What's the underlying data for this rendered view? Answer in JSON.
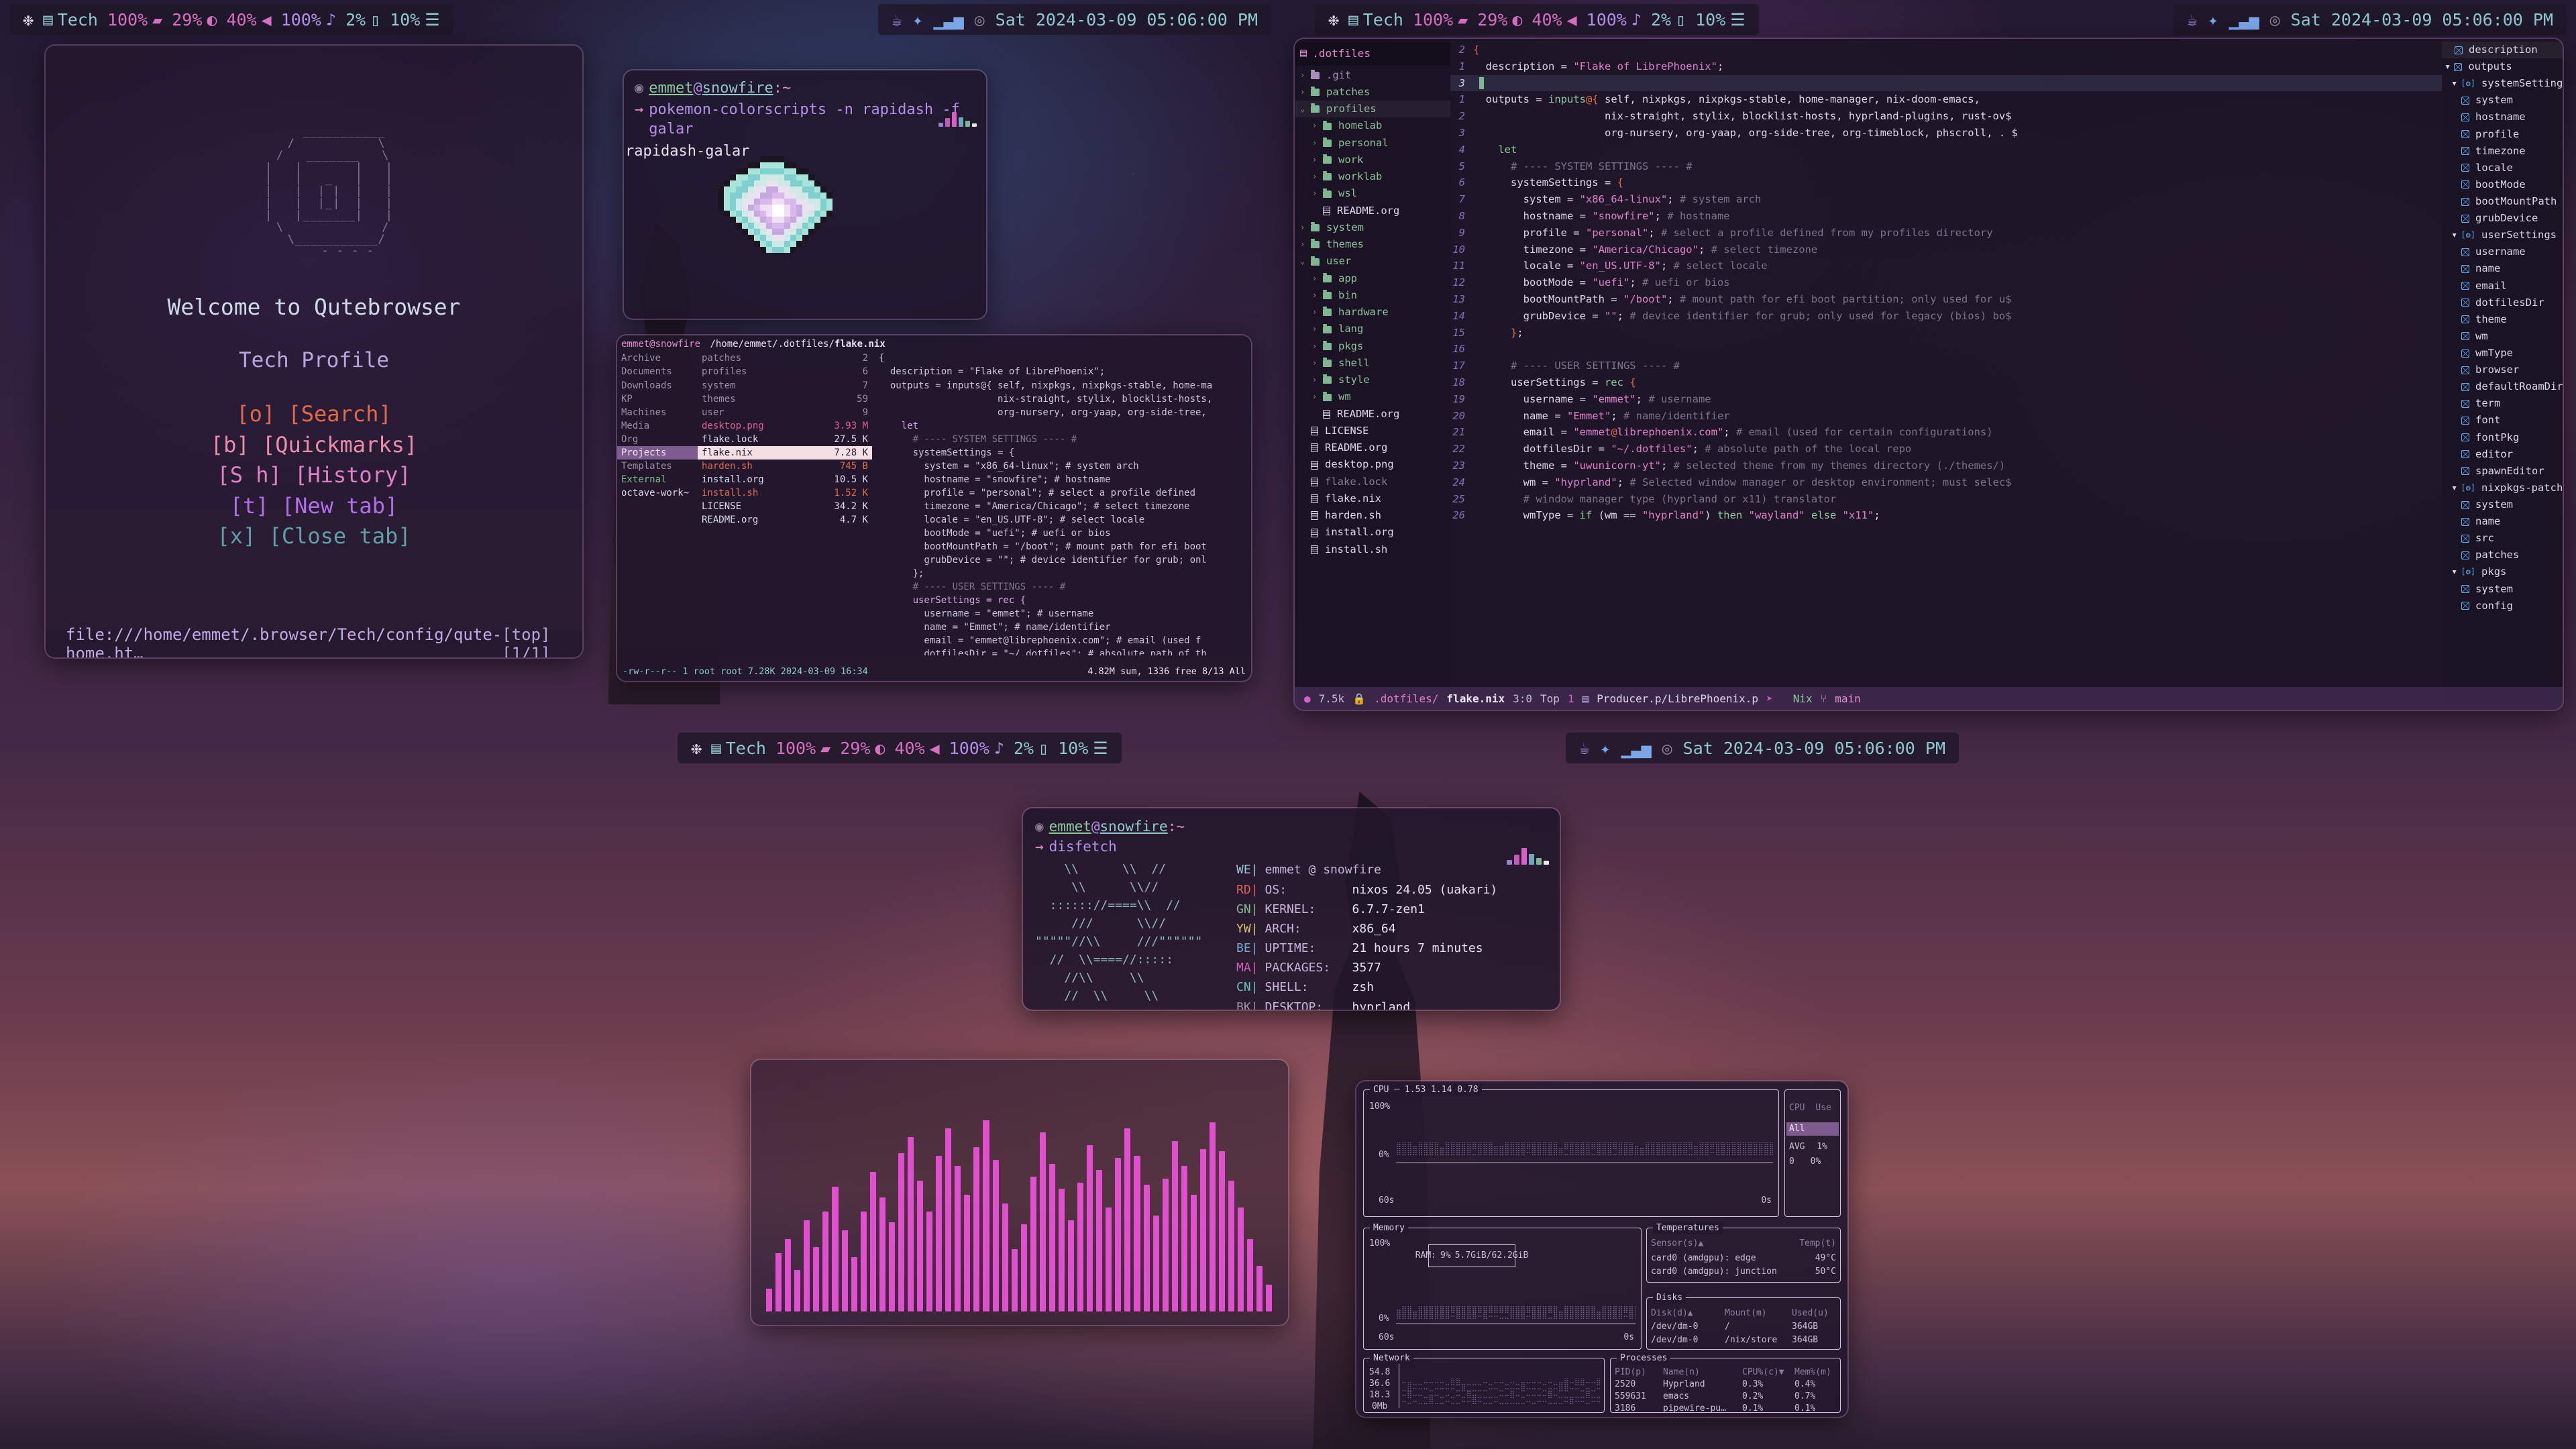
{
  "topbar_left": {
    "icons": [
      "nixos-snowflake-icon",
      "workspace-stack-icon"
    ],
    "workspace": "Tech",
    "items": [
      {
        "name": "battery",
        "value": "100%",
        "icon": "battery-icon"
      },
      {
        "name": "brightness",
        "value": "29%",
        "icon": "brightness-icon"
      },
      {
        "name": "volume-pct",
        "value": "40%",
        "icon": "speaker-icon"
      },
      {
        "name": "mic",
        "value": "100%",
        "icon": "microphone-icon"
      },
      {
        "name": "cpu",
        "value": "2%",
        "icon": "cpu-icon"
      },
      {
        "name": "memory",
        "value": "10%",
        "icon": "memory-icon"
      }
    ]
  },
  "topbar_right": {
    "tray": [
      "coffee-off-icon",
      "bluetooth-icon",
      "network-signal-icon",
      "disc-icon"
    ],
    "clock": "Sat 2024-03-09 05:06:00 PM"
  },
  "qutebrowser": {
    "welcome": "Welcome to Qutebrowser",
    "profile": "Tech Profile",
    "ascii": "        ___________\n      /           \\\n     /   _______   \\\n    |   |       |   |\n    |   |   _   |   |\n    |   |  | |  |   |\n    |   |  |_|  |   |\n    |   |_______|   |\n     \\             /\n      \\___________/\n         - - - -",
    "links": [
      {
        "key": "[o]",
        "label": "[Search]",
        "color": "#e0694a"
      },
      {
        "key": "[b]",
        "label": "[Quickmarks]",
        "color": "#f08bad"
      },
      {
        "key": "[S h]",
        "label": "[History]",
        "color": "#e07fc8"
      },
      {
        "key": "[t]",
        "label": "[New tab]",
        "color": "#b06ee8"
      },
      {
        "key": "[x]",
        "label": "[Close tab]",
        "color": "#5f9fa8"
      }
    ],
    "status_url": "file:///home/emmet/.browser/Tech/config/qute-home.ht…",
    "status_pos": "[top] [1/1]"
  },
  "terminal_top": {
    "prompt_user": "emmet",
    "prompt_at": "@",
    "prompt_host": "snowfire",
    "prompt_path": ":~",
    "command": "pokemon-colorscripts -n rapidash -f galar",
    "output": "rapidash-galar"
  },
  "ranger": {
    "header_user": "emmet@snowfire",
    "header_path": "/home/emmet/.dotfiles/",
    "header_file": "flake.nix",
    "col1": [
      "Archive",
      "Documents",
      "Downloads",
      "KP",
      "Machines",
      "Media",
      "Org",
      "Projects",
      "Templates",
      "External",
      "octave-work~"
    ],
    "col1_selected": "Projects",
    "col2": [
      {
        "name": "patches",
        "size": "2",
        "type": "dir"
      },
      {
        "name": "profiles",
        "size": "6",
        "type": "dir"
      },
      {
        "name": "system",
        "size": "7",
        "type": "dir"
      },
      {
        "name": "themes",
        "size": "59",
        "type": "dir"
      },
      {
        "name": "user",
        "size": "9",
        "type": "dir"
      },
      {
        "name": "desktop.png",
        "size": "3.93 M",
        "type": "image"
      },
      {
        "name": "flake.lock",
        "size": "27.5 K",
        "type": "file"
      },
      {
        "name": "flake.nix",
        "size": "7.28 K",
        "type": "selected"
      },
      {
        "name": "harden.sh",
        "size": "745 B",
        "type": "exec"
      },
      {
        "name": "install.org",
        "size": "10.5 K",
        "type": "file"
      },
      {
        "name": "install.sh",
        "size": "1.52 K",
        "type": "exec"
      },
      {
        "name": "LICENSE",
        "size": "34.2 K",
        "type": "file"
      },
      {
        "name": "README.org",
        "size": "4.7 K",
        "type": "file"
      }
    ],
    "statusline": "-rw-r--r-- 1 root root 7.28K 2024-03-09 16:34",
    "statusright": "4.82M sum, 1336 free  8/13  All",
    "preview": [
      "{",
      "",
      "  description = \"Flake of LibrePhoenix\";",
      "",
      "  outputs = inputs@{ self, nixpkgs, nixpkgs-stable, home-ma",
      "                     nix-straight, stylix, blocklist-hosts,",
      "                     org-nursery, org-yaap, org-side-tree,",
      "",
      "    let",
      "      # ---- SYSTEM SETTINGS ---- #",
      "      systemSettings = {",
      "        system = \"x86_64-linux\"; # system arch",
      "        hostname = \"snowfire\"; # hostname",
      "        profile = \"personal\"; # select a profile defined",
      "        timezone = \"America/Chicago\"; # select timezone",
      "        locale = \"en_US.UTF-8\"; # select locale",
      "        bootMode = \"uefi\"; # uefi or bios",
      "        bootMountPath = \"/boot\"; # mount path for efi boot",
      "        grubDevice = \"\"; # device identifier for grub; onl",
      "      };",
      "",
      "      # ---- USER SETTINGS ---- #",
      "      userSettings = rec {",
      "        username = \"emmet\"; # username",
      "        name = \"Emmet\"; # name/identifier",
      "        email = \"emmet@librephoenix.com\"; # email (used f",
      "        dotfilesDir = \"~/.dotfiles\"; # absolute path of th"
    ]
  },
  "emacs": {
    "project_title": ".dotfiles",
    "tree": [
      {
        "label": ".git",
        "indent": 0,
        "chev": "›",
        "icon": "folder-icon",
        "color": "#a98cc0"
      },
      {
        "label": "patches",
        "indent": 0,
        "chev": "›",
        "icon": "folder-icon"
      },
      {
        "label": "profiles",
        "indent": 0,
        "chev": "⌄",
        "icon": "folder-icon",
        "hl": true
      },
      {
        "label": "homelab",
        "indent": 1,
        "chev": "›",
        "icon": "folder-icon"
      },
      {
        "label": "personal",
        "indent": 1,
        "chev": "›",
        "icon": "folder-icon"
      },
      {
        "label": "work",
        "indent": 1,
        "chev": "›",
        "icon": "folder-icon"
      },
      {
        "label": "worklab",
        "indent": 1,
        "chev": "›",
        "icon": "folder-icon"
      },
      {
        "label": "wsl",
        "indent": 1,
        "chev": "›",
        "icon": "folder-icon"
      },
      {
        "label": "README.org",
        "indent": 1,
        "chev": "",
        "icon": "file-icon",
        "file": true
      },
      {
        "label": "system",
        "indent": 0,
        "chev": "›",
        "icon": "folder-icon"
      },
      {
        "label": "themes",
        "indent": 0,
        "chev": "›",
        "icon": "folder-icon"
      },
      {
        "label": "user",
        "indent": 0,
        "chev": "⌄",
        "icon": "folder-icon"
      },
      {
        "label": "app",
        "indent": 1,
        "chev": "›",
        "icon": "folder-icon"
      },
      {
        "label": "bin",
        "indent": 1,
        "chev": "›",
        "icon": "folder-icon"
      },
      {
        "label": "hardware",
        "indent": 1,
        "chev": "›",
        "icon": "folder-icon"
      },
      {
        "label": "lang",
        "indent": 1,
        "chev": "›",
        "icon": "folder-icon"
      },
      {
        "label": "pkgs",
        "indent": 1,
        "chev": "›",
        "icon": "folder-icon"
      },
      {
        "label": "shell",
        "indent": 1,
        "chev": "›",
        "icon": "folder-icon"
      },
      {
        "label": "style",
        "indent": 1,
        "chev": "›",
        "icon": "folder-icon"
      },
      {
        "label": "wm",
        "indent": 1,
        "chev": "›",
        "icon": "folder-icon"
      },
      {
        "label": "README.org",
        "indent": 1,
        "chev": "",
        "icon": "file-icon",
        "file": true
      },
      {
        "label": "LICENSE",
        "indent": 0,
        "chev": "",
        "icon": "file-icon",
        "file": true
      },
      {
        "label": "README.org",
        "indent": 0,
        "chev": "",
        "icon": "file-icon",
        "file": true
      },
      {
        "label": "desktop.png",
        "indent": 0,
        "chev": "",
        "icon": "image-icon",
        "file": true
      },
      {
        "label": "flake.lock",
        "indent": 0,
        "chev": "",
        "icon": "binary-icon",
        "file": true,
        "dim": true
      },
      {
        "label": "flake.nix",
        "indent": 0,
        "chev": "",
        "icon": "file-icon",
        "file": true
      },
      {
        "label": "harden.sh",
        "indent": 0,
        "chev": "",
        "icon": "binary-icon",
        "file": true
      },
      {
        "label": "install.org",
        "indent": 0,
        "chev": "",
        "icon": "file-icon",
        "file": true
      },
      {
        "label": "install.sh",
        "indent": 0,
        "chev": "",
        "icon": "binary-icon",
        "file": true
      }
    ],
    "code_lines": [
      {
        "num": "2",
        "text": "{"
      },
      {
        "num": "1",
        "text": "  description = \"Flake of LibrePhoenix\";"
      },
      {
        "num": "3",
        "text": "",
        "cursor": true
      },
      {
        "num": "1",
        "text": "  outputs = inputs@{ self, nixpkgs, nixpkgs-stable, home-manager, nix-doom-emacs,"
      },
      {
        "num": "2",
        "text": "                     nix-straight, stylix, blocklist-hosts, hyprland-plugins, rust-ov$"
      },
      {
        "num": "3",
        "text": "                     org-nursery, org-yaap, org-side-tree, org-timeblock, phscroll, . $"
      },
      {
        "num": "4",
        "text": "    let"
      },
      {
        "num": "5",
        "text": "      # ---- SYSTEM SETTINGS ---- #"
      },
      {
        "num": "6",
        "text": "      systemSettings = {"
      },
      {
        "num": "7",
        "text": "        system = \"x86_64-linux\"; # system arch"
      },
      {
        "num": "8",
        "text": "        hostname = \"snowfire\"; # hostname"
      },
      {
        "num": "9",
        "text": "        profile = \"personal\"; # select a profile defined from my profiles directory"
      },
      {
        "num": "10",
        "text": "        timezone = \"America/Chicago\"; # select timezone"
      },
      {
        "num": "11",
        "text": "        locale = \"en_US.UTF-8\"; # select locale"
      },
      {
        "num": "12",
        "text": "        bootMode = \"uefi\"; # uefi or bios"
      },
      {
        "num": "13",
        "text": "        bootMountPath = \"/boot\"; # mount path for efi boot partition; only used for u$"
      },
      {
        "num": "14",
        "text": "        grubDevice = \"\"; # device identifier for grub; only used for legacy (bios) bo$"
      },
      {
        "num": "15",
        "text": "      };"
      },
      {
        "num": "16",
        "text": ""
      },
      {
        "num": "17",
        "text": "      # ---- USER SETTINGS ---- #"
      },
      {
        "num": "18",
        "text": "      userSettings = rec {"
      },
      {
        "num": "19",
        "text": "        username = \"emmet\"; # username"
      },
      {
        "num": "20",
        "text": "        name = \"Emmet\"; # name/identifier"
      },
      {
        "num": "21",
        "text": "        email = \"emmet@librephoenix.com\"; # email (used for certain configurations)"
      },
      {
        "num": "22",
        "text": "        dotfilesDir = \"~/.dotfiles\"; # absolute path of the local repo"
      },
      {
        "num": "23",
        "text": "        theme = \"uwunicorn-yt\"; # selected theme from my themes directory (./themes/)"
      },
      {
        "num": "24",
        "text": "        wm = \"hyprland\"; # Selected window manager or desktop environment; must selec$"
      },
      {
        "num": "25",
        "text": "        # window manager type (hyprland or x11) translator"
      },
      {
        "num": "26",
        "text": "        wmType = if (wm == \"hyprland\") then \"wayland\" else \"x11\";"
      }
    ],
    "imenu": [
      {
        "label": "description",
        "indent": 1,
        "icon": "cube-icon",
        "hl": true
      },
      {
        "label": "outputs",
        "indent": 0,
        "icon": "cube-icon",
        "chev": "▾"
      },
      {
        "label": "systemSettings",
        "indent": 1,
        "icon": "bracket-icon",
        "chev": "▾"
      },
      {
        "label": "system",
        "indent": 2,
        "icon": "cube-icon"
      },
      {
        "label": "hostname",
        "indent": 2,
        "icon": "cube-icon"
      },
      {
        "label": "profile",
        "indent": 2,
        "icon": "cube-icon"
      },
      {
        "label": "timezone",
        "indent": 2,
        "icon": "cube-icon"
      },
      {
        "label": "locale",
        "indent": 2,
        "icon": "cube-icon"
      },
      {
        "label": "bootMode",
        "indent": 2,
        "icon": "cube-icon"
      },
      {
        "label": "bootMountPath",
        "indent": 2,
        "icon": "cube-icon"
      },
      {
        "label": "grubDevice",
        "indent": 2,
        "icon": "cube-icon"
      },
      {
        "label": "userSettings",
        "indent": 1,
        "icon": "bracket-icon",
        "chev": "▾"
      },
      {
        "label": "username",
        "indent": 2,
        "icon": "cube-icon"
      },
      {
        "label": "name",
        "indent": 2,
        "icon": "cube-icon"
      },
      {
        "label": "email",
        "indent": 2,
        "icon": "cube-icon"
      },
      {
        "label": "dotfilesDir",
        "indent": 2,
        "icon": "cube-icon"
      },
      {
        "label": "theme",
        "indent": 2,
        "icon": "cube-icon"
      },
      {
        "label": "wm",
        "indent": 2,
        "icon": "cube-icon"
      },
      {
        "label": "wmType",
        "indent": 2,
        "icon": "cube-icon"
      },
      {
        "label": "browser",
        "indent": 2,
        "icon": "cube-icon"
      },
      {
        "label": "defaultRoamDir",
        "indent": 2,
        "icon": "cube-icon"
      },
      {
        "label": "term",
        "indent": 2,
        "icon": "cube-icon"
      },
      {
        "label": "font",
        "indent": 2,
        "icon": "cube-icon"
      },
      {
        "label": "fontPkg",
        "indent": 2,
        "icon": "cube-icon"
      },
      {
        "label": "editor",
        "indent": 2,
        "icon": "cube-icon"
      },
      {
        "label": "spawnEditor",
        "indent": 2,
        "icon": "cube-icon"
      },
      {
        "label": "nixpkgs-patched",
        "indent": 1,
        "icon": "bracket-icon",
        "chev": "▾"
      },
      {
        "label": "system",
        "indent": 2,
        "icon": "cube-icon"
      },
      {
        "label": "name",
        "indent": 2,
        "icon": "cube-icon"
      },
      {
        "label": "src",
        "indent": 2,
        "icon": "cube-icon"
      },
      {
        "label": "patches",
        "indent": 2,
        "icon": "cube-icon"
      },
      {
        "label": "pkgs",
        "indent": 1,
        "icon": "bracket-icon",
        "chev": "▾"
      },
      {
        "label": "system",
        "indent": 2,
        "icon": "cube-icon"
      },
      {
        "label": "config",
        "indent": 2,
        "icon": "cube-icon"
      }
    ],
    "modeline": {
      "size": "7.5k",
      "lock_icon": "lock-icon",
      "dir": ".dotfiles/",
      "file": "flake.nix",
      "pos": "3:0",
      "scroll": "Top",
      "scroll_num": "1",
      "stack_icon": "stack-icon",
      "project": "Producer.p/LibrePhoenix.p",
      "rocket_icon": "rocket-icon",
      "mode": "Nix",
      "branch_icon": "git-branch-icon",
      "branch": "main"
    }
  },
  "fastfetch": {
    "prompt_user": "emmet",
    "prompt_at": "@",
    "prompt_host": "snowfire",
    "prompt_path": ":~",
    "command": "disfetch",
    "logo": [
      "    \\\\      \\\\  //",
      "     \\\\      \\\\//",
      "  :::::://====\\\\  //",
      "     ///      \\\\//",
      "\"\"\"\"\"//\\\\     ///\"\"\"\"\"\"",
      "  //  \\\\====//:::::",
      "    //\\\\     \\\\",
      "    //  \\\\     \\\\"
    ],
    "color_tags": [
      "WE",
      "RD",
      "GN",
      "YW",
      "BE",
      "MA",
      "CN",
      "BK"
    ],
    "title": "emmet @ snowfire",
    "rows": [
      {
        "key": "OS:",
        "value": "nixos 24.05 (uakari)"
      },
      {
        "key": "KERNEL:",
        "value": "6.7.7-zen1"
      },
      {
        "key": "ARCH:",
        "value": "x86_64"
      },
      {
        "key": "UPTIME:",
        "value": "21 hours 7 minutes"
      },
      {
        "key": "PACKAGES:",
        "value": "3577"
      },
      {
        "key": "SHELL:",
        "value": "zsh"
      },
      {
        "key": "DESKTOP:",
        "value": "hyprland"
      }
    ]
  },
  "visualizer": {
    "bars": [
      22,
      56,
      70,
      40,
      88,
      62,
      96,
      120,
      78,
      52,
      96,
      134,
      110,
      86,
      152,
      168,
      126,
      96,
      150,
      176,
      140,
      112,
      158,
      184,
      146,
      104,
      60,
      84,
      130,
      172,
      142,
      118,
      88,
      124,
      160,
      136,
      100,
      148,
      176,
      150,
      122,
      92,
      128,
      164,
      140,
      112,
      156,
      182,
      154,
      126,
      100,
      70,
      44,
      26
    ]
  },
  "btop": {
    "cpu": {
      "title": "CPU",
      "load": "1.53 1.14 0.78",
      "ymax": "100%",
      "ymin": "0%",
      "xleft": "60s",
      "xright": "0s",
      "side_header": [
        "CPU",
        "Use"
      ],
      "rows": [
        {
          "label": "All",
          "value": "1%",
          "selected": true
        },
        {
          "label": "AVG",
          "value": "1%"
        },
        {
          "label": "0",
          "value": "0%"
        }
      ]
    },
    "memory": {
      "title": "Memory",
      "ymax": "100%",
      "ymin": "0%",
      "xleft": "60s",
      "xright": "0s",
      "ram_label": "RAM:",
      "ram_pct": "9%",
      "ram_value": "5.7GiB/62.2GiB"
    },
    "temperatures": {
      "title": "Temperatures",
      "headers": [
        "Sensor(s)▲",
        "Temp(t)"
      ],
      "rows": [
        {
          "sensor": "card0 (amdgpu): edge",
          "temp": "49°C"
        },
        {
          "sensor": "card0 (amdgpu): junction",
          "temp": "50°C"
        }
      ]
    },
    "disks": {
      "title": "Disks",
      "headers": [
        "Disk(d)▲",
        "Mount(m)",
        "Used(u)"
      ],
      "rows": [
        {
          "disk": "/dev/dm-0",
          "mount": "/",
          "used": "364GB"
        },
        {
          "disk": "/dev/dm-0",
          "mount": "/nix/store",
          "used": "364GB"
        }
      ]
    },
    "network": {
      "title": "Network",
      "yticks": [
        "54.8",
        "36.6",
        "18.3",
        "0Mb"
      ]
    },
    "processes": {
      "title": "Processes",
      "headers": [
        "PID(p)",
        "Name(n)",
        "CPU%(c)▼",
        "Mem%(m)"
      ],
      "rows": [
        {
          "pid": "2520",
          "name": "Hyprland",
          "cpu": "0.3%",
          "mem": "0.4%"
        },
        {
          "pid": "559631",
          "name": "emacs",
          "cpu": "0.2%",
          "mem": "0.7%"
        },
        {
          "pid": "3186",
          "name": "pipewire-pu…",
          "cpu": "0.1%",
          "mem": "0.1%"
        }
      ]
    }
  },
  "colors": {
    "accent_pink": "#e48bd0",
    "accent_cyan": "#8fc8cf",
    "accent_green": "#8ec99b",
    "accent_purple": "#b48ee8",
    "bg": "#221730"
  }
}
